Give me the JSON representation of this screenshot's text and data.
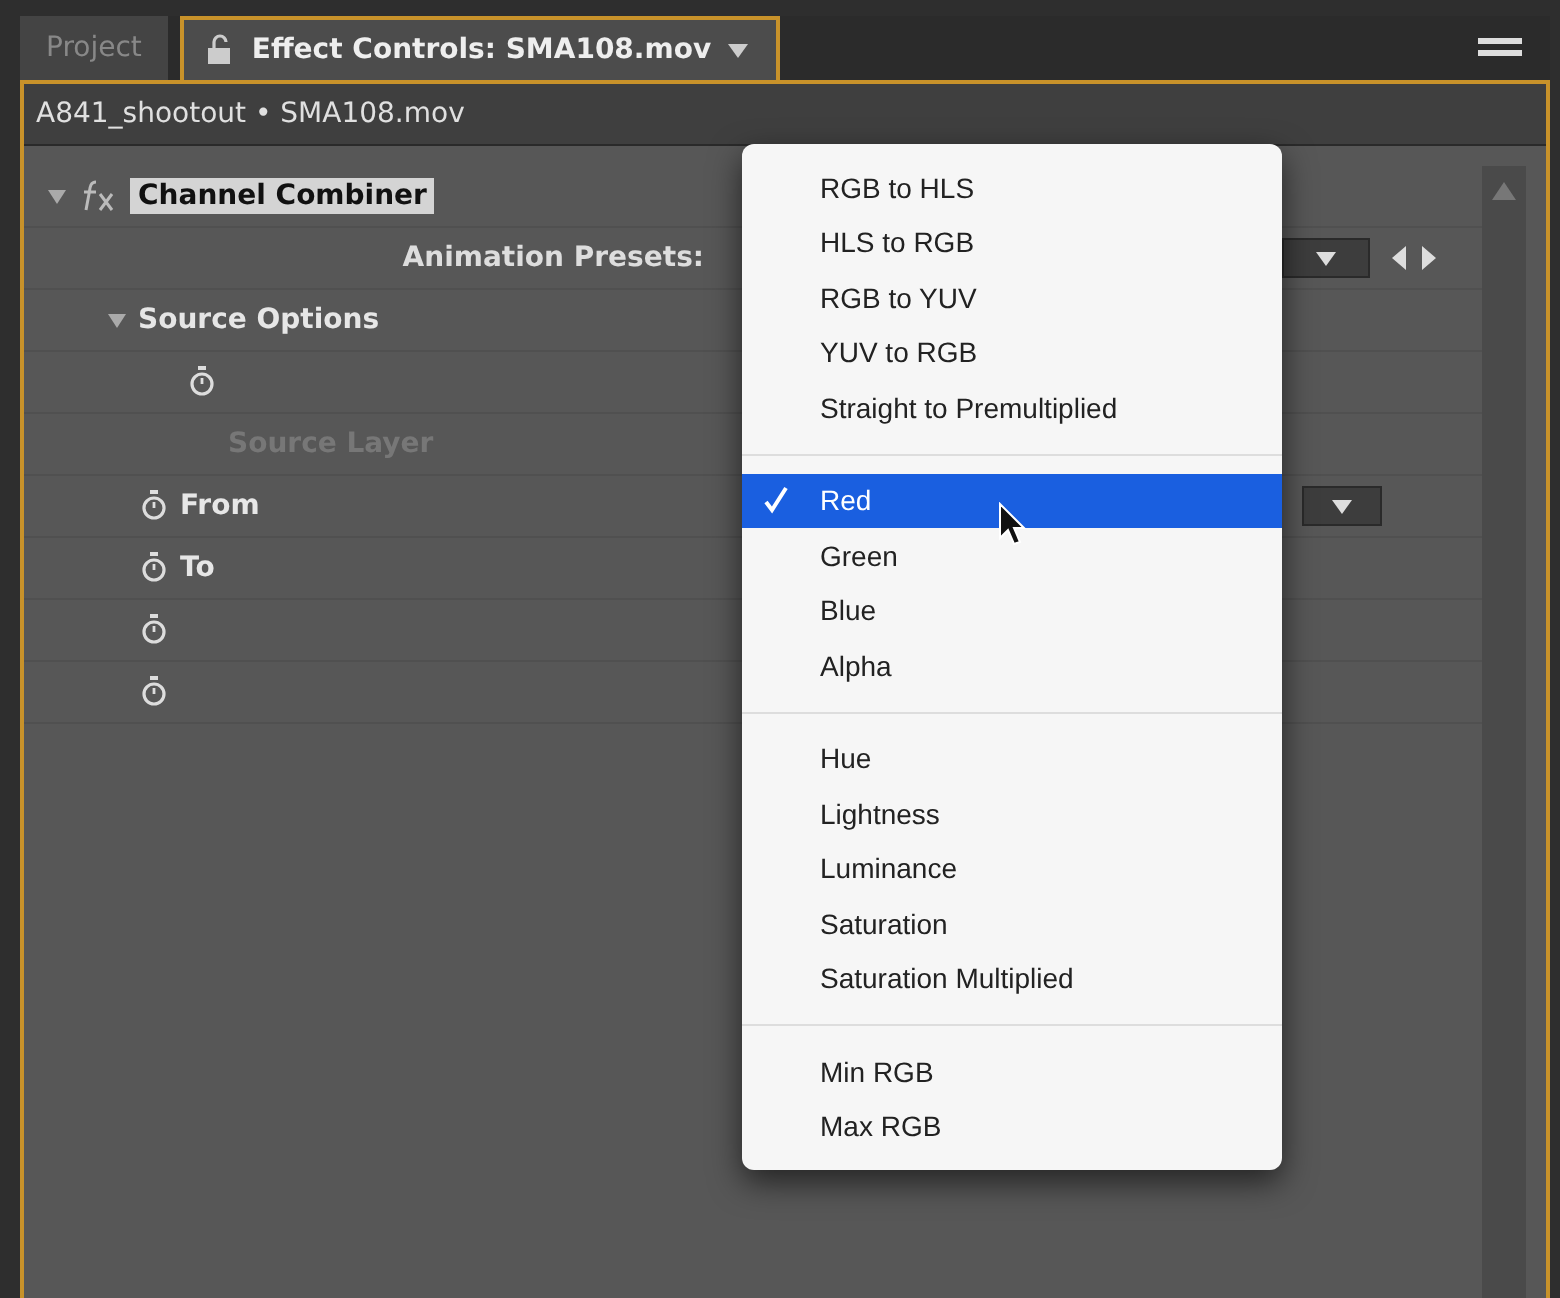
{
  "tabs": [
    {
      "label": "Project",
      "selected": false
    },
    {
      "label": "Effect Controls: SMA108.mov",
      "selected": true
    }
  ],
  "breadcrumb": "A841_shootout • SMA108.mov",
  "effect": {
    "label": "Channel Combiner",
    "expanded": true,
    "children": [
      {
        "kind": "presets",
        "label": "Animation Presets:"
      },
      {
        "kind": "group",
        "label": "Source Options",
        "expanded": true,
        "children": [
          {
            "kind": "property",
            "stopwatch": true,
            "disabled": false,
            "dropdown": false
          },
          {
            "kind": "property",
            "label": "Source Layer",
            "stopwatch": false,
            "disabled": true,
            "dropdown": false
          }
        ]
      },
      {
        "kind": "property",
        "label": "From",
        "stopwatch": true,
        "disabled": false,
        "dropdown": true
      },
      {
        "kind": "property",
        "label": "To",
        "stopwatch": true,
        "disabled": false,
        "dropdown": false
      },
      {
        "kind": "property",
        "stopwatch": true,
        "disabled": false,
        "dropdown": false
      },
      {
        "kind": "property",
        "stopwatch": true,
        "disabled": false,
        "dropdown": false
      }
    ]
  },
  "menu": [
    [
      {
        "label": "RGB to HLS",
        "selected": false
      },
      {
        "label": "HLS to RGB",
        "selected": false
      },
      {
        "label": "RGB to YUV",
        "selected": false
      },
      {
        "label": "YUV to RGB",
        "selected": false
      },
      {
        "label": "Straight to Premultiplied",
        "selected": false
      }
    ],
    [
      {
        "label": "Red",
        "selected": true
      },
      {
        "label": "Green",
        "selected": false
      },
      {
        "label": "Blue",
        "selected": false
      },
      {
        "label": "Alpha",
        "selected": false
      }
    ],
    [
      {
        "label": "Hue",
        "selected": false
      },
      {
        "label": "Lightness",
        "selected": false
      },
      {
        "label": "Luminance",
        "selected": false
      },
      {
        "label": "Saturation",
        "selected": false
      },
      {
        "label": "Saturation Multiplied",
        "selected": false
      }
    ],
    [
      {
        "label": "Min RGB",
        "selected": false
      },
      {
        "label": "Max RGB",
        "selected": false
      }
    ]
  ]
}
